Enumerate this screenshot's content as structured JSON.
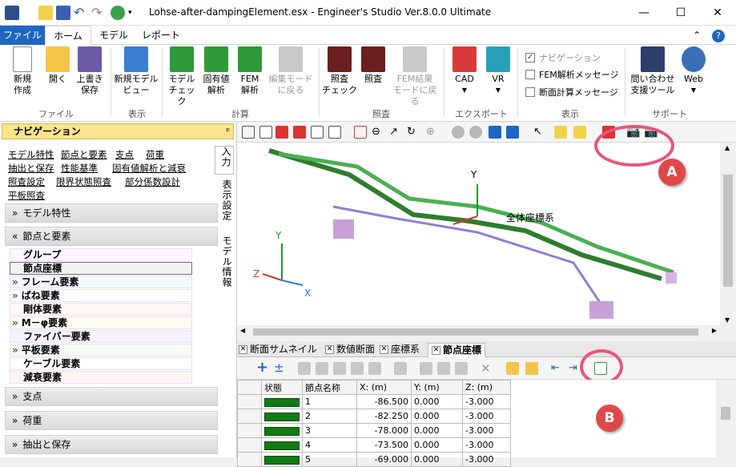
{
  "window": {
    "title": "Lohse-after-dampingElement.esx - Engineer's Studio Ver.8.0.0 Ultimate"
  },
  "ribbon_tabs": [
    {
      "label": "ファイル",
      "active": false,
      "file": true
    },
    {
      "label": "ホーム",
      "active": true
    },
    {
      "label": "モデル",
      "active": false
    },
    {
      "label": "レポート",
      "active": false
    }
  ],
  "ribbon": {
    "new_label": "新規\n作成",
    "open_label": "開く",
    "overwrite_label": "上書き\n保存",
    "file_group": "ファイル",
    "new_model_view_label": "新規モデル\nビュー",
    "display_group": "表示",
    "model_check_label": "モデル\nチェック",
    "eigen_label": "固有値\n解析",
    "fem_label": "FEM\n解析",
    "edit_mode_label": "編集モード\nに戻る",
    "calc_group": "計算",
    "check_verify_label": "照査\nチェック",
    "verify_label": "照査",
    "fem_result_label": "FEM結果\nモードに戻る",
    "verify_group": "照査",
    "cad_label": "CAD",
    "vr_label": "VR",
    "export_group": "エクスポート",
    "nav_checkbox": "ナビゲーション",
    "fem_msg_checkbox": "FEM解析メッセージ",
    "section_msg_checkbox": "断面計算メッセージ",
    "display_group2": "表示",
    "support_tool_label": "問い合わせ\n支援ツール",
    "web_label": "Web",
    "support_group": "サポート"
  },
  "navigation": {
    "header": "ナビゲーション",
    "pin": "📌",
    "links_row1": [
      "モデル特性",
      "節点と要素",
      "支点",
      "荷重"
    ],
    "links_row2": [
      "抽出と保存",
      "性能基準",
      "固有値解析と減衰"
    ],
    "links_row3": [
      "照査設定",
      "限界状態照査",
      "部分係数設計"
    ],
    "links_row4": [
      "平板照査"
    ],
    "sections": [
      {
        "label": "モデル特性",
        "chevron": "»"
      },
      {
        "label": "節点と要素",
        "chevron": "«"
      }
    ],
    "sub_items": [
      {
        "label": "グループ",
        "arrow": ""
      },
      {
        "label": "節点座標",
        "arrow": ""
      },
      {
        "label": "フレーム要素",
        "arrow": "»"
      },
      {
        "label": "ばね要素",
        "arrow": "»"
      },
      {
        "label": "剛体要素",
        "arrow": ""
      },
      {
        "label": "M－φ要素",
        "arrow": "»"
      },
      {
        "label": "ファイバー要素",
        "arrow": ""
      },
      {
        "label": "平板要素",
        "arrow": "»"
      },
      {
        "label": "ケーブル要素",
        "arrow": ""
      },
      {
        "label": "減衰要素",
        "arrow": ""
      }
    ],
    "bottom_sections": [
      {
        "label": "支点",
        "chevron": "»"
      },
      {
        "label": "荷重",
        "chevron": "»"
      },
      {
        "label": "抽出と保存",
        "chevron": "»"
      }
    ],
    "side_tabs": [
      "入力",
      "表示設定",
      "モデル情報"
    ]
  },
  "viewport": {
    "global_label": "全体座標系",
    "axis_y": "Y",
    "axis_x": "X",
    "axis_z": "Z"
  },
  "doc_tabs": [
    "断面サムネイル",
    "数値断面",
    "座標系",
    "節点座標"
  ],
  "table": {
    "headers": [
      "状態",
      "節点名称",
      "X: (m)",
      "Y: (m)",
      "Z: (m)"
    ],
    "rows": [
      {
        "name": "1",
        "x": "-86.500",
        "y": "0.000",
        "z": "-3.000"
      },
      {
        "name": "2",
        "x": "-82.250",
        "y": "0.000",
        "z": "-3.000"
      },
      {
        "name": "3",
        "x": "-78.000",
        "y": "0.000",
        "z": "-3.000"
      },
      {
        "name": "4",
        "x": "-73.500",
        "y": "0.000",
        "z": "-3.000"
      },
      {
        "name": "5",
        "x": "-69.000",
        "y": "0.000",
        "z": "-3.000"
      }
    ]
  },
  "callouts": {
    "a": "A",
    "b": "B"
  },
  "colors": {
    "accent": "#1e66c3",
    "callout": "#e04848",
    "ring": "#e8567a",
    "status_ok": "#117a11"
  }
}
